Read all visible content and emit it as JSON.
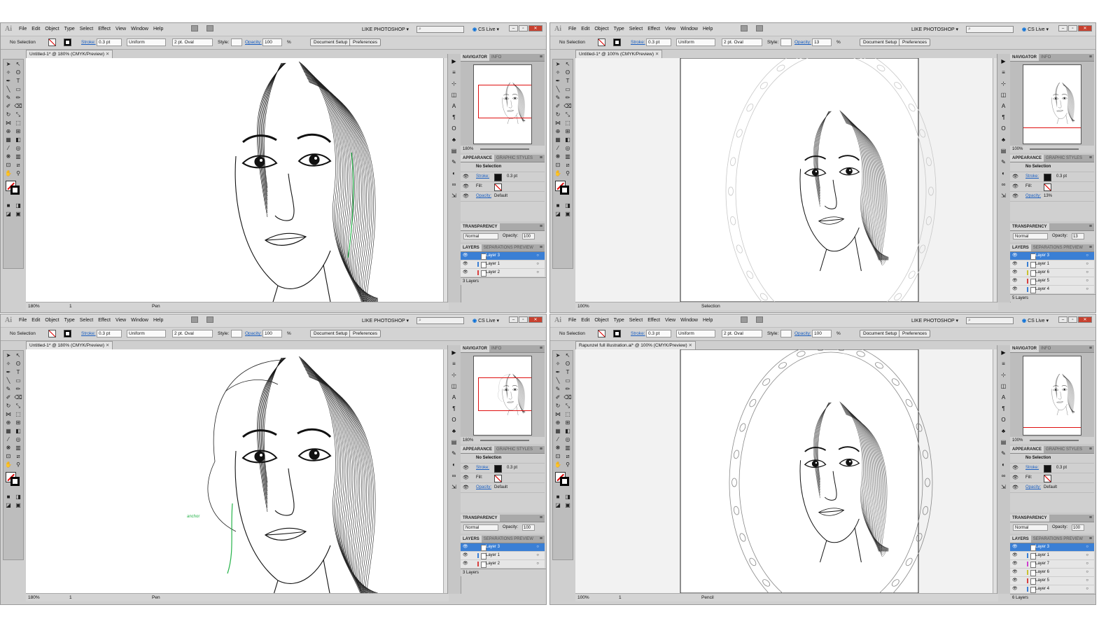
{
  "common": {
    "app_logo": "Ai",
    "menus": [
      "File",
      "Edit",
      "Object",
      "Type",
      "Select",
      "Effect",
      "View",
      "Window",
      "Help"
    ],
    "workspace": "LIKE PHOTOSHOP",
    "cs_live_icon": "cs-live-icon",
    "cs_live": "CS Live",
    "no_selection": "No Selection",
    "stroke_label": "Stroke:",
    "stroke_weight": "0.3 pt",
    "profile": "Uniform",
    "brush": "2 pt. Oval",
    "style_label": "Style:",
    "opacity_label": "Opacity:",
    "percent": "%",
    "document_setup": "Document Setup",
    "preferences": "Preferences",
    "navigator_tab": "NAVIGATOR",
    "info_tab": "INFO",
    "appearance_tab": "APPEARANCE",
    "graphic_styles_tab": "GRAPHIC STYLES",
    "appearance_title": "No Selection",
    "appearance_stroke": "Stroke:",
    "appearance_fill": "Fill:",
    "appearance_opacity": "Opacity:",
    "transparency_tab": "TRANSPARENCY",
    "blend_mode": "Normal",
    "opacity_short": "Opacity:",
    "layers_tab": "LAYERS",
    "separations_tab": "SEPARATIONS PREVIEW",
    "pen_hint": "anchor"
  },
  "windows": [
    {
      "doc_title": "Untitled-1* @ 180% (CMYK/Preview)",
      "opacity": "100",
      "zoom": "180%",
      "zoom_nav": "180%",
      "appearance_opacity_value": "Default",
      "transparency_opacity": "100",
      "artboard": "1",
      "tool": "Pen",
      "layers": [
        {
          "name": "Layer 3",
          "selected": true,
          "color": "#3a7fd5"
        },
        {
          "name": "Layer 1",
          "selected": false,
          "color": "#3a7fd5"
        },
        {
          "name": "Layer 2",
          "selected": false,
          "color": "#d94040"
        }
      ],
      "layer_count": "3 Layers"
    },
    {
      "doc_title": "Untitled-1* @ 100% (CMYK/Preview)",
      "opacity": "13",
      "zoom": "100%",
      "zoom_nav": "100%",
      "appearance_opacity_value": "13%",
      "transparency_opacity": "13",
      "artboard": "",
      "tool": "Selection",
      "layers": [
        {
          "name": "Layer 3",
          "selected": true,
          "color": "#3a7fd5"
        },
        {
          "name": "Layer 1",
          "selected": false,
          "color": "#3a7fd5"
        },
        {
          "name": "Layer 6",
          "selected": false,
          "color": "#c9c230"
        },
        {
          "name": "Layer 5",
          "selected": false,
          "color": "#d94040"
        },
        {
          "name": "Layer 4",
          "selected": false,
          "color": "#3a7fd5"
        }
      ],
      "layer_count": "5 Layers"
    },
    {
      "doc_title": "Untitled-1* @ 180% (CMYK/Preview)",
      "opacity": "100",
      "zoom": "180%",
      "zoom_nav": "180%",
      "appearance_opacity_value": "Default",
      "transparency_opacity": "100",
      "artboard": "1",
      "tool": "Pen",
      "layers": [
        {
          "name": "Layer 3",
          "selected": true,
          "color": "#3a7fd5"
        },
        {
          "name": "Layer 1",
          "selected": false,
          "color": "#3a7fd5"
        },
        {
          "name": "Layer 2",
          "selected": false,
          "color": "#d94040"
        }
      ],
      "layer_count": "3 Layers"
    },
    {
      "doc_title": "Rapunzel full illustration.ai* @ 100% (CMYK/Preview)",
      "opacity": "100",
      "zoom": "100%",
      "zoom_nav": "100%",
      "appearance_opacity_value": "Default",
      "transparency_opacity": "100",
      "artboard": "1",
      "tool": "Pencil",
      "layers": [
        {
          "name": "Layer 3",
          "selected": true,
          "color": "#3a7fd5"
        },
        {
          "name": "Layer 1",
          "selected": false,
          "color": "#3a7fd5"
        },
        {
          "name": "Layer 7",
          "selected": false,
          "color": "#d040d0"
        },
        {
          "name": "Layer 6",
          "selected": false,
          "color": "#c9c230"
        },
        {
          "name": "Layer 5",
          "selected": false,
          "color": "#d94040"
        },
        {
          "name": "Layer 4",
          "selected": false,
          "color": "#3a7fd5"
        }
      ],
      "layer_count": "6 Layers"
    }
  ]
}
